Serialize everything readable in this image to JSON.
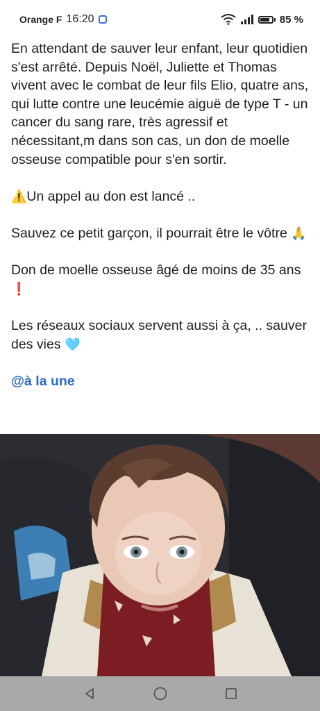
{
  "status_bar": {
    "carrier": "Orange F",
    "time": "16:20",
    "battery_percent": "85 %",
    "battery_level": 0.85
  },
  "post": {
    "paragraph_1": "En attendant de sauver leur enfant, leur quotidien s'est arrêté. Depuis Noël, Juliette et Thomas vivent avec le combat de leur fils Elio, quatre ans, qui lutte contre une leucémie aiguë de type T - un cancer du sang rare, très agressif et nécessitant,m dans son cas, un don de moelle osseuse compatible pour s'en sortir.",
    "paragraph_2": "Un appel au don est lancé ..",
    "paragraph_3": "Sauvez ce petit garçon, il pourrait être le vôtre",
    "paragraph_4": "Don de moelle osseuse âgé de moins de 35 ans",
    "paragraph_5": "Les réseaux sociaux servent aussi à ça, .. sauver des vies",
    "hashtag": "@à la une"
  },
  "emojis": {
    "warning": "⚠️",
    "pray": "🙏",
    "exclamation": "❗",
    "heart": "🩵"
  },
  "icons": {
    "wifi": "wifi-icon",
    "signal": "signal-icon",
    "battery": "battery-icon",
    "back": "back-icon",
    "home": "home-icon",
    "recents": "recents-icon"
  },
  "colors": {
    "text": "#1c1e21",
    "link": "#2b6cc4",
    "nav_bar": "#a9a9a9",
    "notification": "#3b6fd8"
  }
}
